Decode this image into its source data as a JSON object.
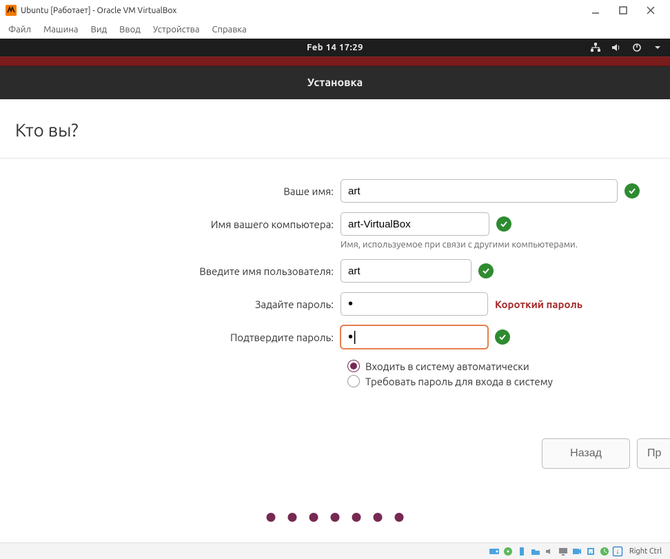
{
  "vb": {
    "title": "Ubuntu [Работает] - Oracle VM VirtualBox",
    "menu": {
      "file": "Файл",
      "machine": "Машина",
      "view": "Вид",
      "input": "Ввод",
      "devices": "Устройства",
      "help": "Справка"
    },
    "hostkey": "Right Ctrl"
  },
  "topbar": {
    "datetime": "Feb 14  17:29"
  },
  "installer": {
    "header_title": "Установка",
    "heading": "Кто вы?",
    "labels": {
      "name": "Ваше имя:",
      "computer": "Имя вашего компьютера:",
      "computer_hint": "Имя, используемое при связи с другими компьютерами.",
      "username": "Введите имя пользователя:",
      "password": "Задайте пароль:",
      "password_warn": "Короткий пароль",
      "confirm": "Подтвердите пароль:",
      "radio_auto": "Входить в систему автоматически",
      "radio_require": "Требовать пароль для входа в систему"
    },
    "values": {
      "name": "art",
      "computer": "art-VirtualBox",
      "username": "art",
      "password": "•",
      "confirm": "•|"
    },
    "buttons": {
      "back": "Назад",
      "continue_cut": "Пр"
    }
  },
  "colors": {
    "accent": "#772953",
    "success": "#2e8b30",
    "warn": "#a52a2a",
    "focus": "#e77e4c"
  }
}
